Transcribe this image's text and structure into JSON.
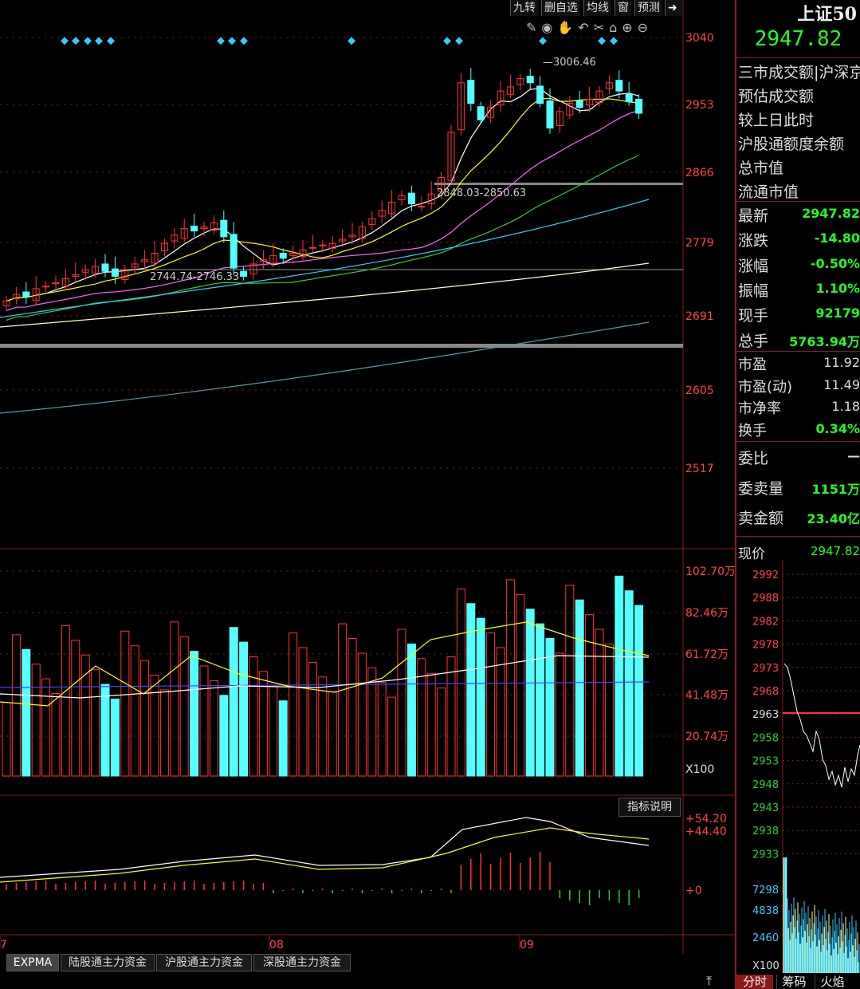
{
  "toolbar": {
    "btn1": "九转",
    "btn2": "删自选",
    "btn3": "均线",
    "btn4": "窗",
    "btn5": "预测"
  },
  "icons": [
    "pen-icon",
    "eye-icon",
    "hand-icon",
    "undo-icon",
    "scissors-icon",
    "lock-icon",
    "zoom-in-icon",
    "zoom-out-icon",
    "arrow-right-icon"
  ],
  "price_axis": [
    "3040",
    "2953",
    "2866",
    "2779",
    "2691",
    "2605",
    "2517"
  ],
  "annotations": {
    "high": "3006.46",
    "gap1": "2848.03-2850.63",
    "gap2": "2744.74-2746.33"
  },
  "volume_axis": [
    "102.70万",
    "82.46万",
    "61.72万",
    "41.48万",
    "20.74万",
    "X100"
  ],
  "indicator": {
    "explain_btn": "指标说明",
    "v1": "+54.20",
    "v2": "+44.40",
    "v3": "+0"
  },
  "x_labels": [
    "7",
    "08",
    "09"
  ],
  "bottom_tabs": [
    "EXPMA",
    "陆股通主力资金",
    "沪股通主力资金",
    "深股通主力资金"
  ],
  "right": {
    "title": "上证50",
    "price": "2947.82",
    "info_rows": [
      "三市成交额|沪深京",
      "预估成交额",
      "较上日此时",
      "沪股通额度余额",
      "总市值",
      "流通市值"
    ],
    "quote_rows": [
      {
        "label": "最新",
        "value": "2947.82"
      },
      {
        "label": "涨跌",
        "value": "-14.80"
      },
      {
        "label": "涨幅",
        "value": "-0.50%"
      },
      {
        "label": "振幅",
        "value": "1.10%"
      },
      {
        "label": "现手",
        "value": "92179"
      },
      {
        "label": "总手",
        "value": "5763.94万"
      }
    ],
    "val_rows": [
      {
        "label": "市盈",
        "value": "11.92"
      },
      {
        "label": "市盈(动)",
        "value": "11.49"
      },
      {
        "label": "市净率",
        "value": "1.18"
      },
      {
        "label": "换手",
        "value": "0.34%"
      }
    ],
    "order_rows": [
      {
        "label": "委比",
        "value": "—"
      },
      {
        "label": "委卖量",
        "value": "1151万"
      },
      {
        "label": "卖金额",
        "value": "23.40亿"
      }
    ],
    "mini_label": "现价",
    "mini_value": "2947.82",
    "mini_axis": [
      "2992",
      "2988",
      "2982",
      "2978",
      "2973",
      "2968",
      "2963",
      "2958",
      "2953",
      "2948",
      "2943",
      "2938",
      "2933"
    ],
    "mini_vol_axis": [
      "7298",
      "4838",
      "2460",
      "X100"
    ],
    "tabs": [
      "分时",
      "筹码",
      "火焰"
    ]
  },
  "colors": {
    "up": "#ff3333",
    "down": "#55ffff",
    "bg": "#000000",
    "grid": "#8a1a1a"
  },
  "chart_data": {
    "type": "candlestick",
    "title": "",
    "price_range": [
      2480,
      3060
    ],
    "high_label": 3006.46
  }
}
